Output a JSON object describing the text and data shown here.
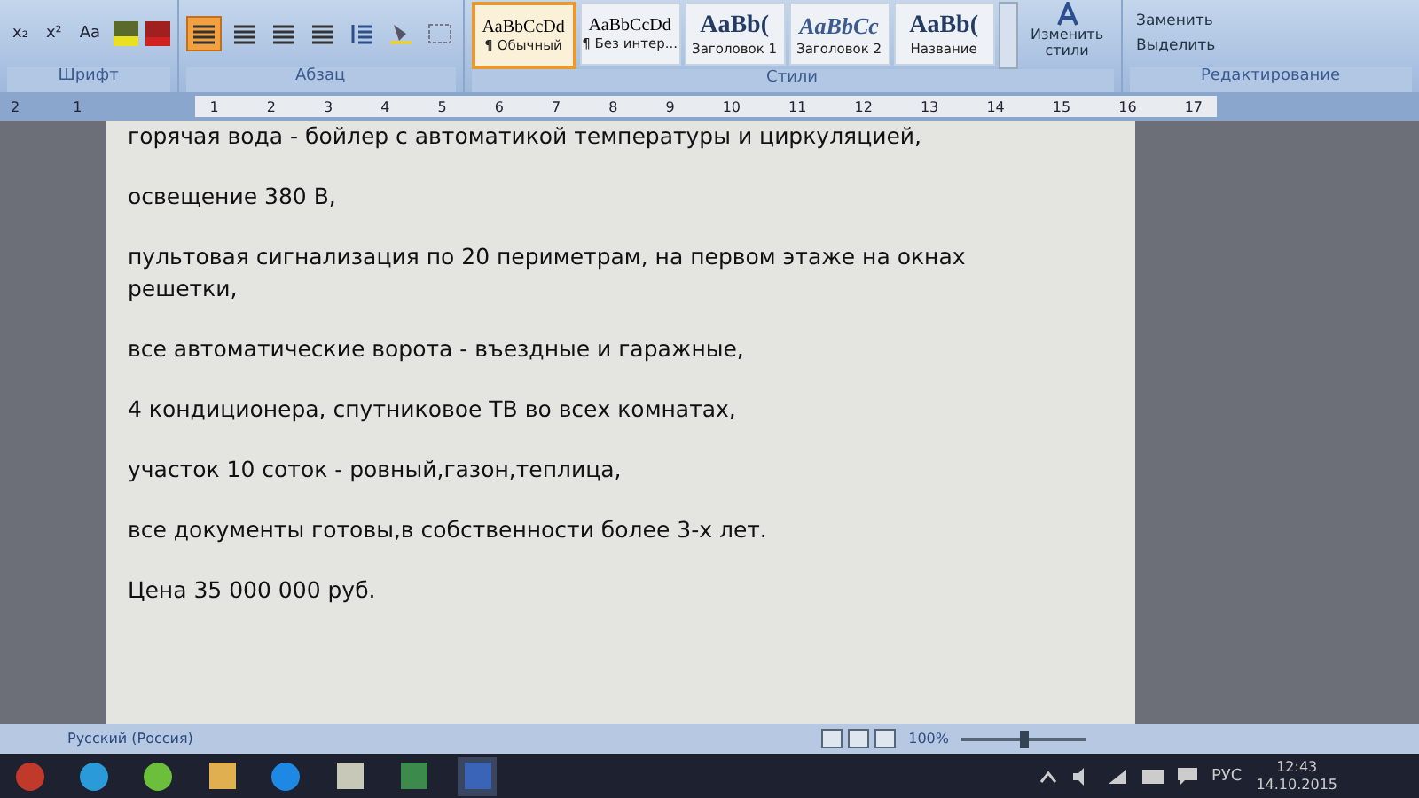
{
  "ribbon": {
    "font_group": {
      "label": "Шрифт",
      "buttons": [
        "x₂",
        "x²",
        "Aa"
      ]
    },
    "paragraph_group": {
      "label": "Абзац",
      "alignments": [
        {
          "selected": true
        },
        {
          "selected": false
        },
        {
          "selected": false
        },
        {
          "selected": false
        }
      ]
    },
    "styles_group": {
      "label": "Стили",
      "styles": [
        {
          "sample": "AaBbCcDd",
          "name": "¶ Обычный",
          "selected": true,
          "kind": "body"
        },
        {
          "sample": "AaBbCcDd",
          "name": "¶ Без интер...",
          "selected": false,
          "kind": "body"
        },
        {
          "sample": "AaBb(",
          "name": "Заголовок 1",
          "selected": false,
          "kind": "heading"
        },
        {
          "sample": "AaBbCc",
          "name": "Заголовок 2",
          "selected": false,
          "kind": "italic"
        },
        {
          "sample": "AaBb(",
          "name": "Название",
          "selected": false,
          "kind": "heading"
        }
      ],
      "change_styles": "Изменить стили"
    },
    "editing_group": {
      "label": "Редактирование",
      "buttons": [
        "Заменить",
        "Выделить"
      ]
    }
  },
  "ruler": {
    "left_marks": [
      "2",
      "1"
    ],
    "marks": [
      "1",
      "2",
      "3",
      "4",
      "5",
      "6",
      "7",
      "8",
      "9",
      "10",
      "11",
      "12",
      "13",
      "14",
      "15",
      "16",
      "17"
    ]
  },
  "document": {
    "paragraphs": [
      "горячая вода - бойлер с автоматикой температуры и циркуляцией,",
      "освещение 380 В,",
      "пультовая сигнализация по 20 периметрам, на первом этаже на окнах решетки,",
      "все автоматические ворота - въездные и гаражные,",
      "4 кондиционера, спутниковое ТВ во всех комнатах,",
      "участок 10 соток - ровный,газон,теплица,",
      "все документы готовы,в собственности более 3-х лет.",
      "Цена 35 000 000 руб."
    ]
  },
  "status_bar": {
    "language": "Русский (Россия)",
    "zoom": "100%",
    "zoom_level": {
      "level": 0.5
    }
  },
  "taskbar": {
    "language": "РУС",
    "time": "12:43",
    "date": "14.10.2015"
  }
}
